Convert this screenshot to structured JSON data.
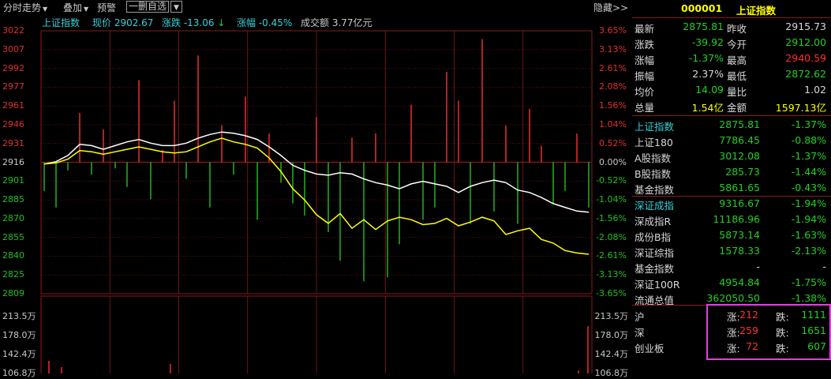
{
  "toolbar": {
    "items": [
      "分时走势",
      "叠加",
      "预警"
    ],
    "select_label": "一删自选",
    "right_label": "隐藏>>"
  },
  "chart": {
    "info": {
      "index_name": "上证指数",
      "price": "现价 2902.67",
      "change": "涨跌 -13.06",
      "change_arrow": "↓",
      "pct": "涨幅 -0.45%",
      "volume": "成交额 3.77亿元"
    },
    "price_ticks_left": [
      "3022",
      "3007",
      "2992",
      "2977",
      "2961",
      "2946",
      "2931",
      "2916",
      "2901",
      "2885",
      "2870",
      "2855",
      "2840",
      "2825",
      "2809"
    ],
    "pct_ticks_right": [
      "3.65%",
      "3.13%",
      "2.61%",
      "2.08%",
      "1.56%",
      "1.04%",
      "0.52%",
      "0.00%",
      "-0.52%",
      "-1.04%",
      "-1.56%",
      "-2.08%",
      "-2.61%",
      "-3.13%",
      "-3.65%"
    ],
    "vol_ticks_left": [
      "213.5万",
      "178.0万",
      "142.4万",
      "106.8万"
    ],
    "vol_ticks_right": [
      "213.5万",
      "178.0万",
      "142.4万",
      "106.8万"
    ],
    "colors": {
      "up": "#ff3030",
      "down": "#22c022",
      "price_line": "#ffffff",
      "avg_line": "#ffff00",
      "grid": "#8a1a1a"
    }
  },
  "chart_data": {
    "type": "line",
    "title": "上证指数",
    "xlabel": "",
    "ylabel": "",
    "ylim": [
      2809,
      3022
    ],
    "series": [
      {
        "name": "",
        "values": [
          2914,
          2916,
          2921,
          2930,
          2929,
          2926,
          2929,
          2932,
          2934,
          2931,
          2929,
          2929,
          2931,
          2935,
          2938,
          2940,
          2939,
          2937,
          2934,
          2928,
          2921,
          2913,
          2909,
          2906,
          2905,
          2907,
          2906,
          2902,
          2899,
          2897,
          2894,
          2898,
          2900,
          2898,
          2896,
          2891,
          2896,
          2899,
          2901,
          2899,
          2893,
          2891,
          2887,
          2882,
          2879,
          2876,
          2875
        ]
      },
      {
        "name": "",
        "values": [
          2914,
          2915,
          2918,
          2925,
          2924,
          2922,
          2924,
          2926,
          2928,
          2926,
          2924,
          2923,
          2924,
          2928,
          2932,
          2935,
          2932,
          2930,
          2927,
          2919,
          2908,
          2894,
          2885,
          2873,
          2866,
          2874,
          2862,
          2869,
          2861,
          2868,
          2871,
          2869,
          2865,
          2866,
          2870,
          2864,
          2867,
          2871,
          2868,
          2857,
          2860,
          2862,
          2853,
          2850,
          2844,
          2842,
          2841
        ]
      }
    ],
    "volume": [
      -14,
      -22,
      -4,
      24,
      -6,
      16,
      -3,
      -12,
      40,
      -18,
      6,
      30,
      -8,
      52,
      -22,
      18,
      -6,
      32,
      -28,
      14,
      -10,
      -20,
      -26,
      22,
      -34,
      -48,
      12,
      -58,
      14,
      -56,
      -40,
      28,
      -28,
      -22,
      44,
      30,
      -30,
      60,
      -24,
      18,
      -30,
      26,
      8,
      -20,
      -14,
      14,
      -22
    ]
  },
  "side": {
    "header": {
      "code": "000001",
      "name": "上证指数"
    },
    "quote": [
      {
        "l1": "最新",
        "v1": "2875.81",
        "l2": "昨收",
        "v2": "2915.73",
        "c1": "dn",
        "c2": "wt"
      },
      {
        "l1": "涨跌",
        "v1": "-39.92",
        "l2": "今开",
        "v2": "2912.00",
        "c1": "dn",
        "c2": "dn"
      },
      {
        "l1": "涨幅",
        "v1": "-1.37%",
        "l2": "最高",
        "v2": "2940.59",
        "c1": "dn",
        "c2": "up"
      },
      {
        "l1": "振幅",
        "v1": "2.37%",
        "l2": "最低",
        "v2": "2872.62",
        "c1": "wt",
        "c2": "dn"
      },
      {
        "l1": "均价",
        "v1": "14.09",
        "l2": "量比",
        "v2": "1.02",
        "c1": "dn",
        "c2": "wt"
      },
      {
        "l1": "总量",
        "v1": "1.54亿",
        "l2": "金额",
        "v2": "1597.13亿",
        "c1": "hl",
        "c2": "hl"
      }
    ],
    "indices_sh": [
      {
        "name": "上证指数",
        "value": "2875.81",
        "pct": "-1.37%",
        "hl": true
      },
      {
        "name": "上证180",
        "value": "7786.45",
        "pct": "-0.88%",
        "hl": false
      },
      {
        "name": "A股指数",
        "value": "3012.08",
        "pct": "-1.37%",
        "hl": false
      },
      {
        "name": "B股指数",
        "value": "285.73",
        "pct": "-1.44%",
        "hl": false
      },
      {
        "name": "基金指数",
        "value": "5861.65",
        "pct": "-0.43%",
        "hl": false
      }
    ],
    "indices_sz": [
      {
        "name": "深证成指",
        "value": "9316.67",
        "pct": "-1.94%",
        "hl": true
      },
      {
        "name": "深成指R",
        "value": "11186.96",
        "pct": "-1.94%",
        "hl": false
      },
      {
        "name": "成份B指",
        "value": "5873.14",
        "pct": "-1.63%",
        "hl": false
      },
      {
        "name": "深证综指",
        "value": "1578.33",
        "pct": "-2.13%",
        "hl": false
      },
      {
        "name": "基金指数",
        "value": "-",
        "pct": "-",
        "hl": false
      },
      {
        "name": "深证100R",
        "value": "4954.84",
        "pct": "-1.75%",
        "hl": false
      },
      {
        "name": "流通总值",
        "value": "362050.50",
        "pct": "-1.38%",
        "hl": false
      }
    ],
    "breadth": [
      {
        "market": "沪",
        "up_label": "涨:",
        "up": "212",
        "down_label": "跌:",
        "down": "1111"
      },
      {
        "market": "深",
        "up_label": "涨:",
        "up": "259",
        "down_label": "跌:",
        "down": "1651"
      },
      {
        "market": "创业板",
        "up_label": "涨:",
        "up": "72",
        "down_label": "跌:",
        "down": "607"
      }
    ]
  }
}
